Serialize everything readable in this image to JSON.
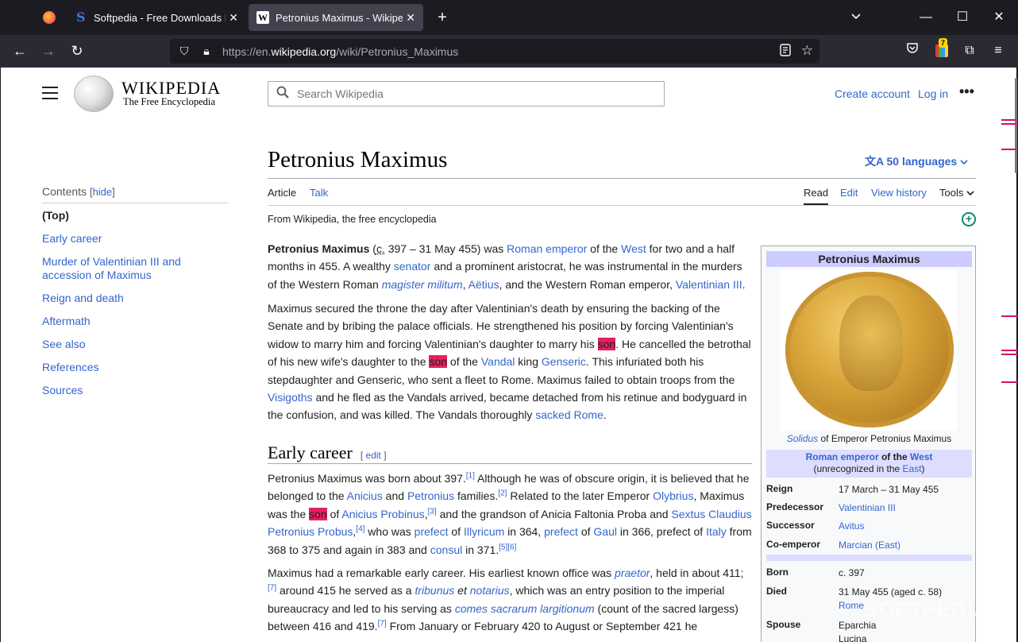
{
  "browser": {
    "tabs": [
      {
        "title": "Softpedia - Free Downloads Enc",
        "icon": "softpedia-favicon"
      },
      {
        "title": "Petronius Maximus - Wikipedia",
        "icon": "wikipedia-favicon",
        "active": true
      }
    ],
    "url_prefix": "https://en.",
    "url_host": "wikipedia.org",
    "url_path": "/wiki/Petronius_Maximus",
    "extension_badge": "7"
  },
  "header": {
    "wordmark": "WIKIPEDIA",
    "tagline": "The Free Encyclopedia",
    "search_placeholder": "Search Wikipedia",
    "create_account": "Create account",
    "log_in": "Log in"
  },
  "toc": {
    "title": "Contents",
    "hide": "hide",
    "items": [
      "(Top)",
      "Early career",
      "Murder of Valentinian III and accession of Maximus",
      "Reign and death",
      "Aftermath",
      "See also",
      "References",
      "Sources"
    ]
  },
  "article": {
    "title": "Petronius Maximus",
    "languages": "50 languages",
    "tabs": {
      "article": "Article",
      "talk": "Talk",
      "read": "Read",
      "edit": "Edit",
      "history": "View history",
      "tools": "Tools"
    },
    "from": "From Wikipedia, the free encyclopedia",
    "section_early": "Early career",
    "edit_label": "edit"
  },
  "infobox": {
    "title": "Petronius Maximus",
    "caption_italic": "Solidus",
    "caption_rest": " of Emperor Petronius Maximus",
    "role_link1": "Roman emperor",
    "role_mid": " of the ",
    "role_link2": "West",
    "role_line2_pre": "(unrecognized in the ",
    "role_line2_link": "East",
    "role_line2_post": ")",
    "rows": [
      {
        "key": "Reign",
        "value": "17 March – 31 May 455"
      },
      {
        "key": "Predecessor",
        "value": "Valentinian III"
      },
      {
        "key": "Successor",
        "value": "Avitus"
      },
      {
        "key": "Co-emperor",
        "value": "Marcian (East)"
      },
      {
        "key": "Born",
        "value": "c. 397"
      },
      {
        "key": "Died",
        "value": "31 May 455 (aged c. 58)"
      },
      {
        "key": "Died_place",
        "value": "Rome"
      },
      {
        "key": "Spouse",
        "value": "Eparchia"
      },
      {
        "key": "Spouse2",
        "value": "Lucina"
      }
    ]
  },
  "watermark": "SOFTPEDIA®"
}
